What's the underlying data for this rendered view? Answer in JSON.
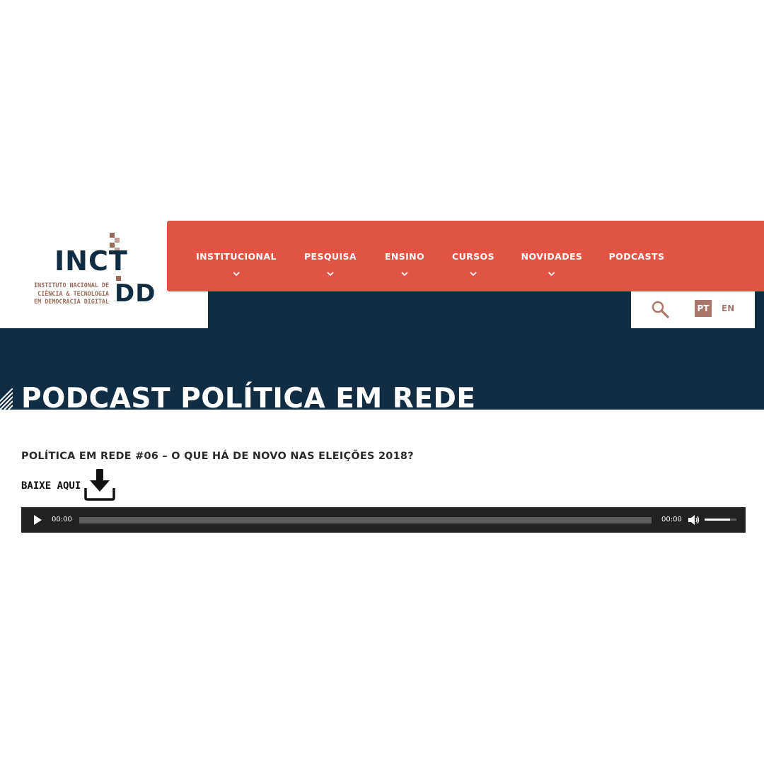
{
  "logo": {
    "acronym_top": "INCT",
    "acronym_bottom": "DD",
    "subtitle_lines": [
      "INSTITUTO NACIONAL DE",
      "CIÊNCIA & TECNOLOGIA",
      "EM DEMOCRACIA DIGITAL"
    ]
  },
  "nav": {
    "items": [
      {
        "label": "INSTITUCIONAL",
        "has_dropdown": true
      },
      {
        "label": "PESQUISA",
        "has_dropdown": true
      },
      {
        "label": "ENSINO",
        "has_dropdown": true
      },
      {
        "label": "CURSOS",
        "has_dropdown": true
      },
      {
        "label": "NOVIDADES",
        "has_dropdown": true
      },
      {
        "label": "PODCASTS",
        "has_dropdown": false
      }
    ]
  },
  "utility": {
    "search_icon": "search-icon",
    "languages": {
      "active": "PT",
      "other": "EN"
    }
  },
  "page": {
    "title": "PODCAST POLÍTICA EM REDE"
  },
  "episode": {
    "title": "POLÍTICA EM REDE #06 – O QUE HÁ DE NOVO NAS ELEIÇÕES 2018?",
    "download_label": "BAIXE AQUI",
    "download_icon": "download-icon"
  },
  "player": {
    "current_time": "00:00",
    "duration": "00:00",
    "progress_fraction": 0,
    "volume_fraction": 0.8
  },
  "colors": {
    "nav_red": "#e15444",
    "navy": "#112d43",
    "accent_brown": "#a8776a",
    "player_bg": "#222222"
  }
}
